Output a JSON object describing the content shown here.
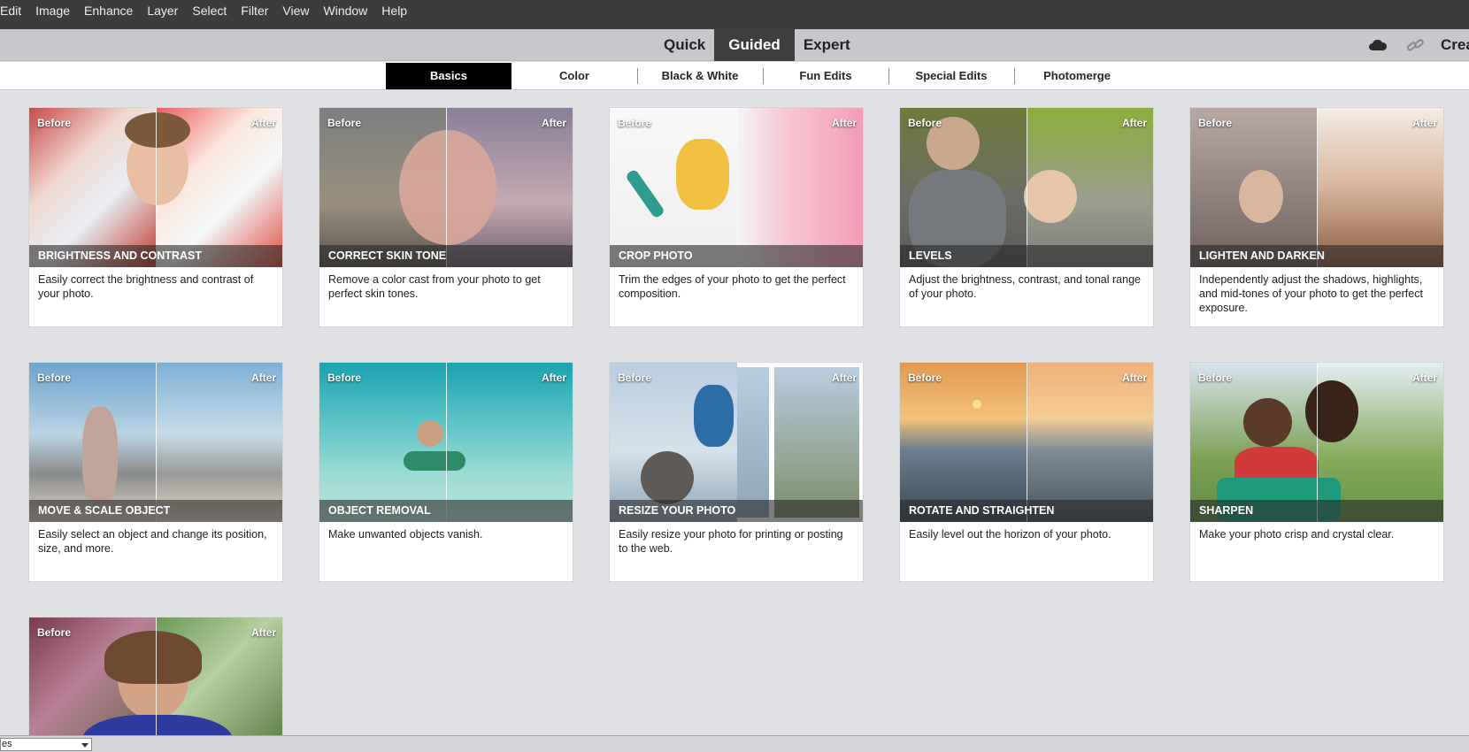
{
  "menu": {
    "items": [
      "Edit",
      "Image",
      "Enhance",
      "Layer",
      "Select",
      "Filter",
      "View",
      "Window",
      "Help"
    ]
  },
  "modes": {
    "tabs": [
      "Quick",
      "Guided",
      "Expert"
    ],
    "active": "Guided",
    "create_label": "Crea",
    "icons": [
      "cloud-icon",
      "link-icon"
    ]
  },
  "subtabs": {
    "items": [
      "Basics",
      "Color",
      "Black & White",
      "Fun Edits",
      "Special Edits",
      "Photomerge"
    ],
    "active": "Basics"
  },
  "labels": {
    "before": "Before",
    "after": "After"
  },
  "cards": [
    {
      "title": "Brightness and Contrast",
      "desc": "Easily correct the brightness and contrast of your photo."
    },
    {
      "title": "Correct Skin Tone",
      "desc": "Remove a color cast from your photo to get perfect skin tones."
    },
    {
      "title": "Crop Photo",
      "desc": "Trim the edges of your photo to get the perfect composition."
    },
    {
      "title": "Levels",
      "desc": "Adjust the brightness, contrast, and tonal range of your photo."
    },
    {
      "title": "Lighten and Darken",
      "desc": "Independently adjust the shadows, highlights, and mid-tones of your photo to get the perfect exposure."
    },
    {
      "title": "Move & Scale Object",
      "desc": "Easily select an object and change its position, size, and more."
    },
    {
      "title": "Object Removal",
      "desc": "Make unwanted objects vanish."
    },
    {
      "title": "Resize Your Photo",
      "desc": "Easily resize your photo for printing or posting to the web."
    },
    {
      "title": "Rotate and Straighten",
      "desc": "Easily level out the horizon of your photo."
    },
    {
      "title": "Sharpen",
      "desc": "Make your photo crisp and crystal clear."
    },
    {
      "title": "",
      "desc": ""
    }
  ],
  "bottom": {
    "select_value": "es"
  },
  "colors": {
    "menubar": "#3c3c3c",
    "active_mode": "#3e3e3e",
    "active_subtab": "#000000",
    "page_bg": "#e1e2e5"
  }
}
